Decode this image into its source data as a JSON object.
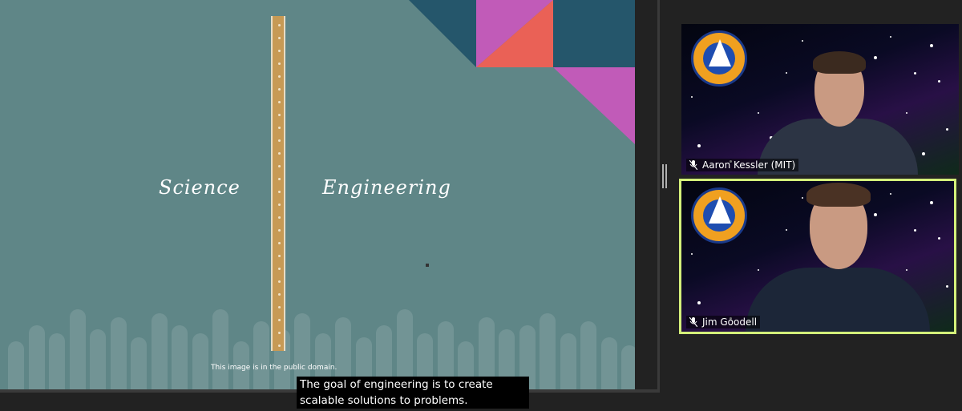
{
  "slide": {
    "left_word": "Science",
    "right_word": "Engineering",
    "image_note": "This image is in the public domain."
  },
  "caption": {
    "text": "The goal of engineering is to create scalable solutions to problems."
  },
  "participants": [
    {
      "name": "Aaron Kessler (MIT)",
      "icon": "muted-mic-icon",
      "active_speaker": false
    },
    {
      "name": "Jim Goodell",
      "icon": "muted-mic-icon",
      "active_speaker": true
    }
  ],
  "colors": {
    "slide_bg": "#5f8687",
    "active_speaker_border": "#d4f07a",
    "shape_navy": "#25566b",
    "shape_magenta": "#c15bb8",
    "shape_coral": "#ea6156"
  }
}
